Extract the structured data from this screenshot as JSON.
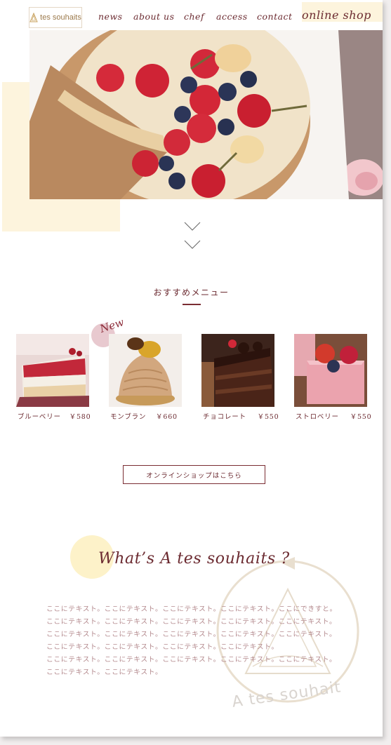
{
  "header": {
    "logo_text": "tes souhaits",
    "nav": [
      "news",
      "about us",
      "chef",
      "access",
      "contact"
    ],
    "shop_label": "online shop"
  },
  "hero": {
    "alt_icon": "cheesecake-photo"
  },
  "scroll_icon": "double-chevron-down-icon",
  "recommend": {
    "title": "おすすめメニュー",
    "new_label": "New",
    "items": [
      {
        "name": "ブルーベリー",
        "price": "￥580"
      },
      {
        "name": "モンブラン",
        "price": "￥660"
      },
      {
        "name": "チョコレート",
        "price": "￥550"
      },
      {
        "name": "ストロベリー",
        "price": "￥550"
      }
    ]
  },
  "cta_label": "オンラインショップはこちら",
  "about": {
    "title": "What’s A tes souhaits ?",
    "lines": [
      "ここにテキスト。ここにテキスト。ここにテキスト。ここにテキスト。ここにできすと。",
      "ここにテキスト。ここにテキスト。ここにテキスト。ここにテキスト。ここにテキスト。",
      "ここにテキスト。ここにテキスト。ここにテキスト。ここにテキスト。ここにテキスト。",
      "ここにテキスト。ここにテキスト。ここにテキスト。ここにテキスト。",
      "ここにテキスト。ここにテキスト。ここにテキスト。ここにテキスト。ここにテキスト。",
      "ここにテキスト。ここにテキスト。"
    ],
    "watermark_text": "A tes souhait"
  },
  "colors": {
    "accent": "#6b2a30",
    "cream": "#fdf4dd",
    "pink": "#e8c9cf"
  }
}
